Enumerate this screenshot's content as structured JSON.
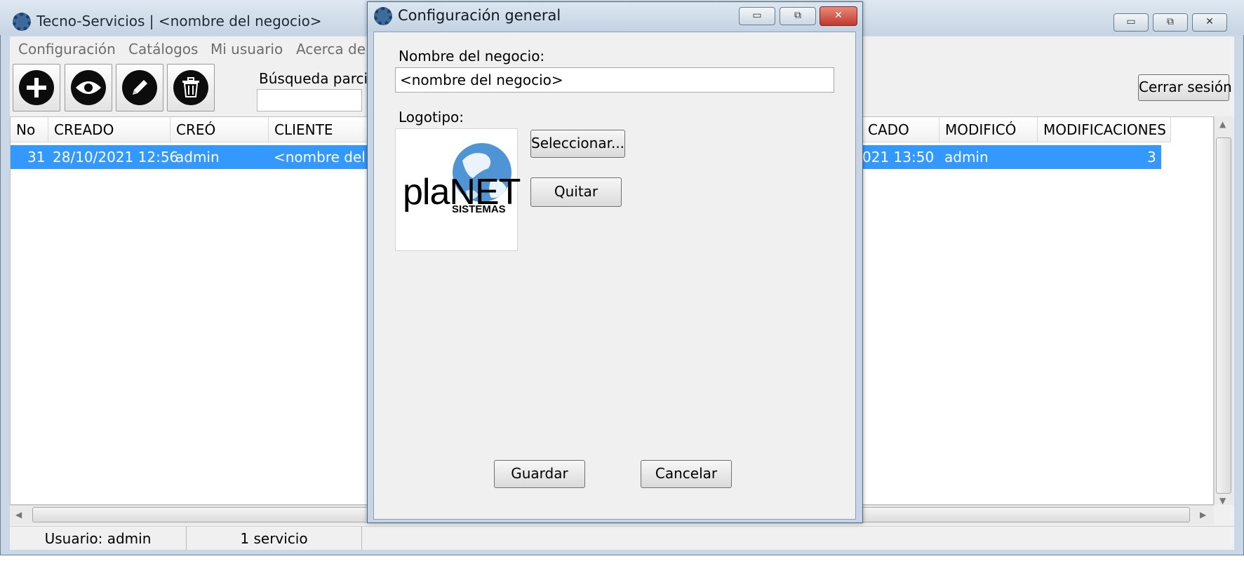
{
  "main_window": {
    "title": "Tecno-Servicios | <nombre del negocio>",
    "minimize": "▭",
    "maximize": "⧉",
    "close": "✕"
  },
  "menu": [
    {
      "label": "Configuración"
    },
    {
      "label": "Catálogos"
    },
    {
      "label": "Mi usuario"
    },
    {
      "label": "Acerca de e"
    }
  ],
  "toolbar": {
    "add_icon": "plus-icon",
    "view_icon": "eye-icon",
    "edit_icon": "pencil-icon",
    "delete_icon": "trash-icon",
    "search_label": "Búsqueda parcia",
    "search_value": "",
    "logout_label": "Cerrar sesión"
  },
  "table": {
    "columns": [
      "No",
      "CREADO",
      "CREÓ",
      "CLIENTE",
      "CADO",
      "MODIFICÓ",
      "MODIFICACIONES"
    ],
    "rows": [
      {
        "no": "31",
        "created": "28/10/2021 12:56",
        "creator": "admin",
        "client": "<nombre del c",
        "modified": "021 13:50",
        "modifier": "admin",
        "modifications": "3"
      }
    ]
  },
  "status": {
    "user": "Usuario: admin",
    "count": "1 servicio"
  },
  "dialog": {
    "title": "Configuración general",
    "minimize": "▭",
    "maximize": "⧉",
    "close": "✕",
    "business_name_label": "Nombre del negocio:",
    "business_name_value": "<nombre del negocio>",
    "logo_label": "Logotipo:",
    "logo_text_main": "plaNET",
    "logo_text_sub": "SISTEMAS",
    "select_button": "Seleccionar...",
    "remove_button": "Quitar",
    "save_button": "Guardar",
    "cancel_button": "Cancelar"
  },
  "colors": {
    "selection": "#3399ff",
    "titlebar": "#c9d7e6",
    "close_button": "#c0392b"
  }
}
